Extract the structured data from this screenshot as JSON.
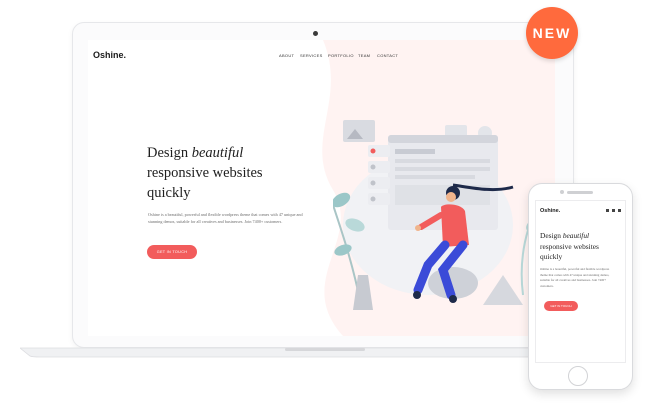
{
  "badge": {
    "label": "NEW",
    "color": "#ff6a3d"
  },
  "site": {
    "logo": "Oshine.",
    "nav": [
      "ABOUT",
      "SERVICES",
      "PORTFOLIO",
      "TEAM",
      "CONTACT"
    ],
    "headline_line1_prefix": "Design",
    "headline_line1_emph": "beautiful",
    "headline_line2": "responsive websites",
    "headline_line3": "quickly",
    "body": "Oshine is a beautiful, powerful and flexible wordpress theme that comes with 47 unique and stunning demos, suitable for all creatives and businesses. Join 7400+ customers.",
    "cta": "GET IN TOUCH",
    "accent": "#f25c5c"
  },
  "mobile": {
    "logo": "Oshine.",
    "headline_line1_prefix": "Design",
    "headline_line1_emph": "beautiful",
    "headline_line2": "responsive websites",
    "headline_line3": "quickly",
    "body": "Oshine is a beautiful, powerful and flexible wordpress theme that comes with 47 unique and stunning demos, suitable for all creatives and businesses. Join 7400+ customers.",
    "cta": "GET IN TOUCH"
  }
}
